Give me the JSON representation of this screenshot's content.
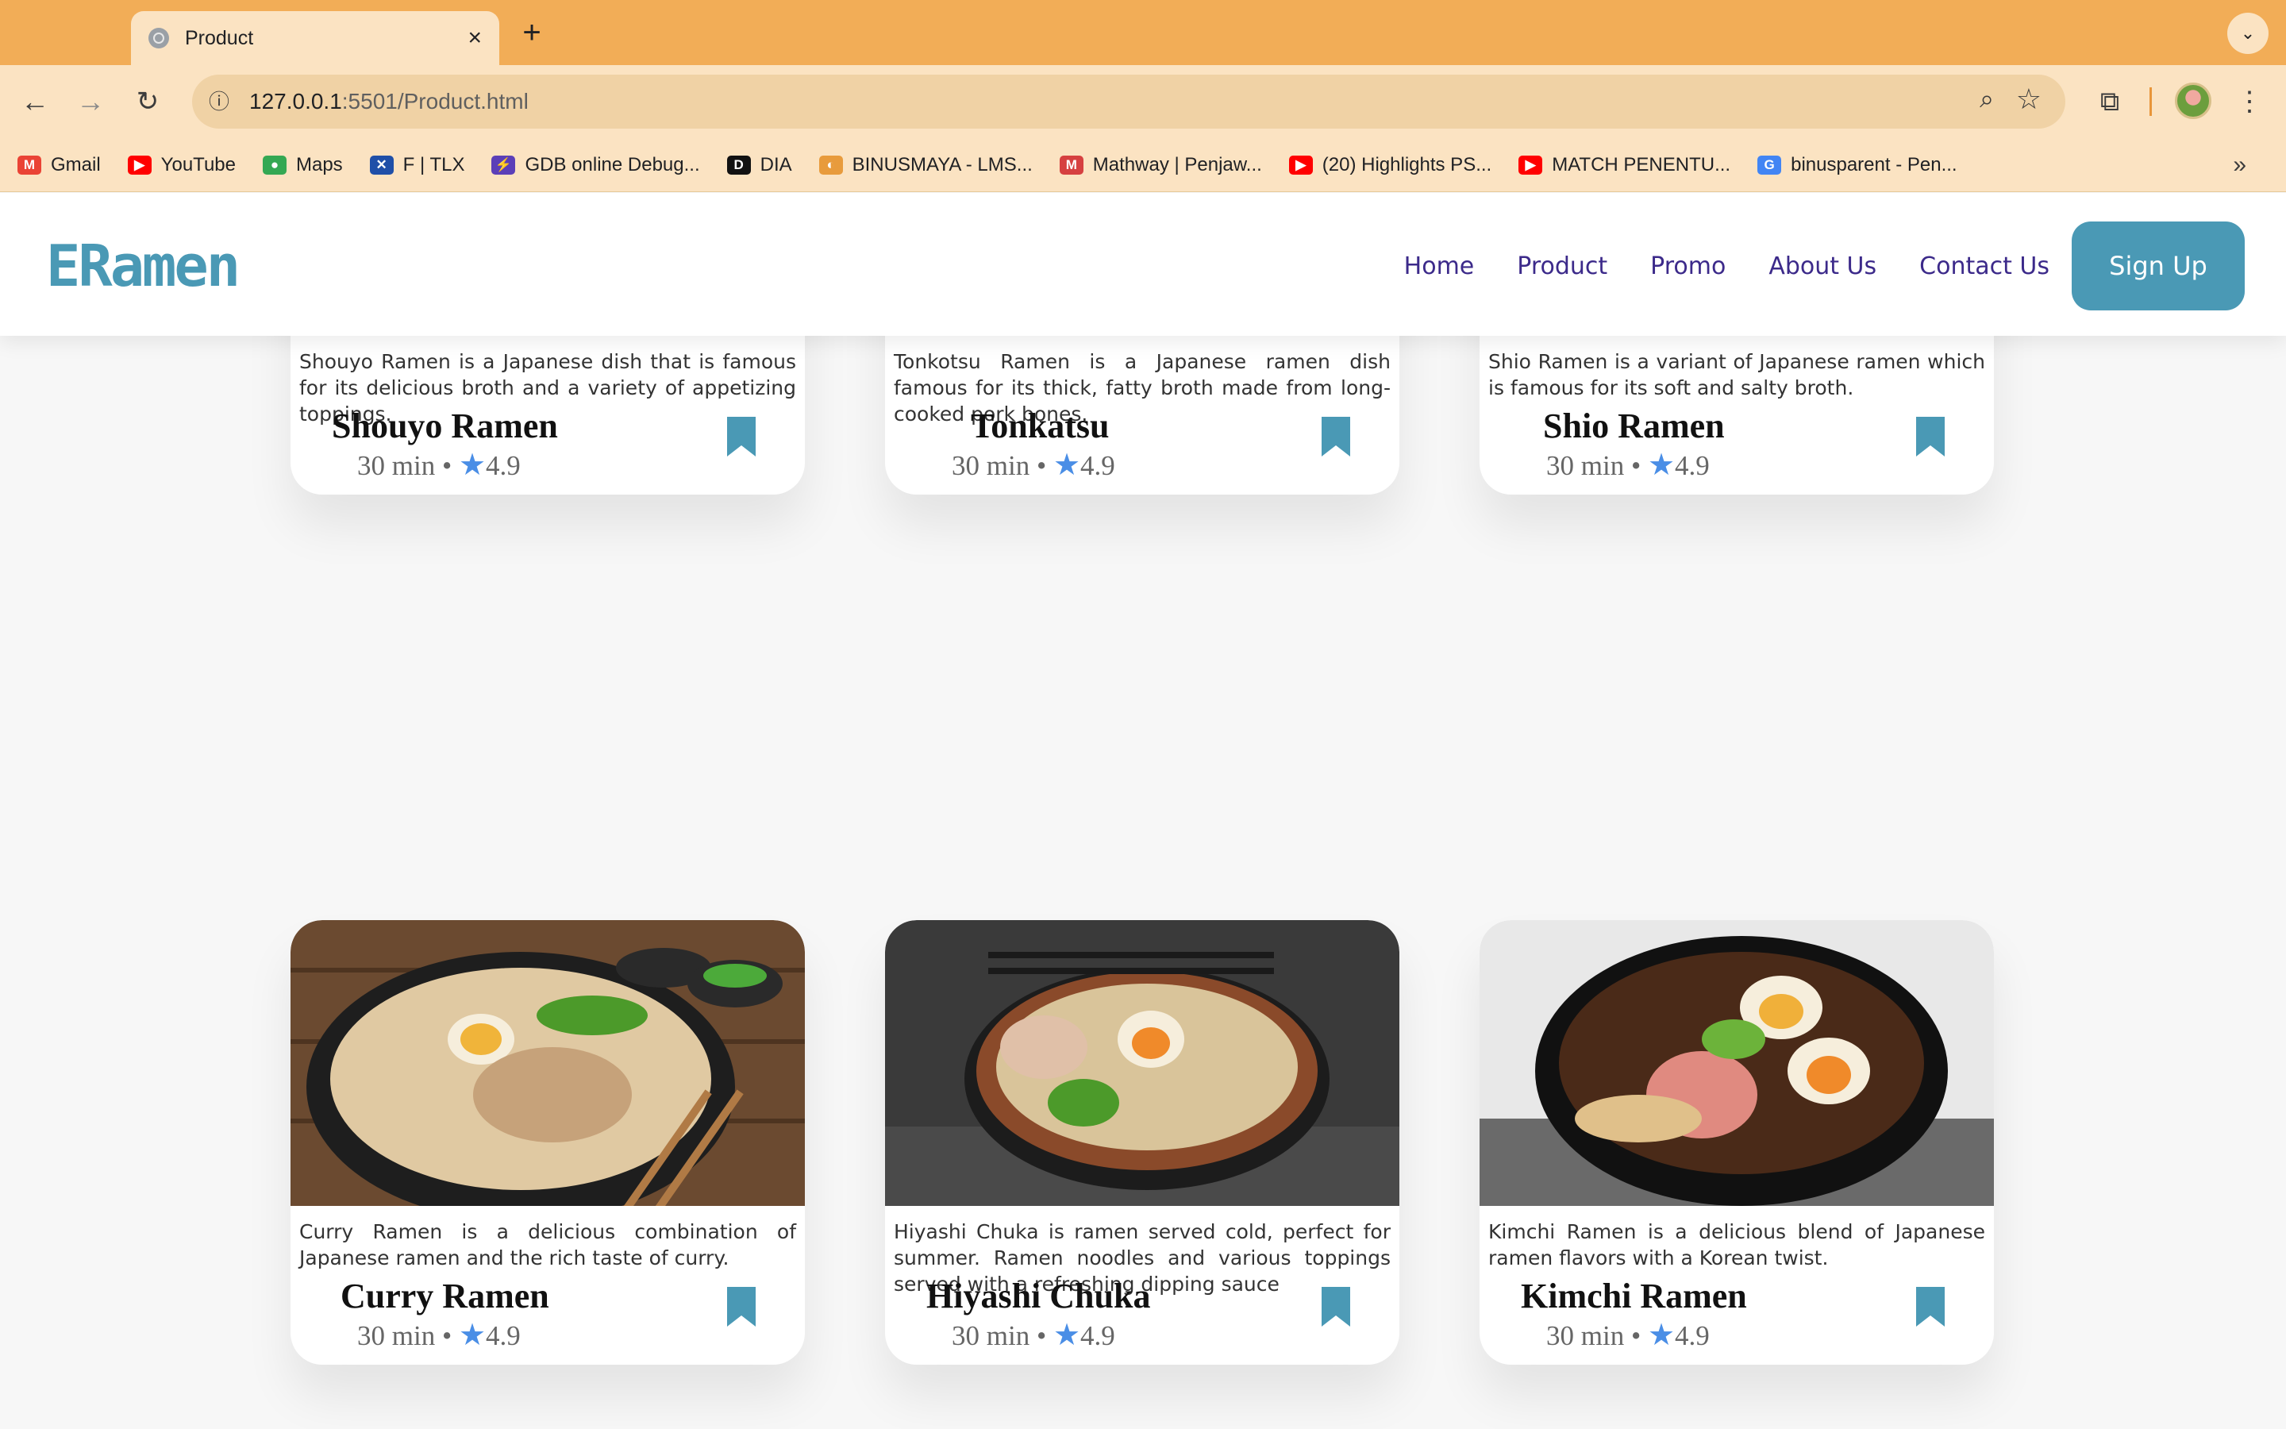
{
  "browser": {
    "tab_title": "Product",
    "url_host": "127.0.0.1",
    "url_path": ":5501/Product.html",
    "accent": "#f2ad57"
  },
  "bookmarks": [
    {
      "label": "Gmail",
      "icon": "gmail-icon",
      "color": "#ea4335",
      "glyph": "M"
    },
    {
      "label": "YouTube",
      "icon": "youtube-icon",
      "color": "#ff0000",
      "glyph": "▶"
    },
    {
      "label": "Maps",
      "icon": "maps-icon",
      "color": "#34a853",
      "glyph": "●"
    },
    {
      "label": "F | TLX",
      "icon": "tlx-icon",
      "color": "#1f4fa8",
      "glyph": "✕"
    },
    {
      "label": "GDB online Debug...",
      "icon": "gdb-icon",
      "color": "#5b3fb8",
      "glyph": "⚡"
    },
    {
      "label": "DIA",
      "icon": "dia-icon",
      "color": "#111111",
      "glyph": "D"
    },
    {
      "label": "BINUSMAYA - LMS...",
      "icon": "binus-icon",
      "color": "#e89b3c",
      "glyph": "◐"
    },
    {
      "label": "Mathway | Penjaw...",
      "icon": "mathway-icon",
      "color": "#d64040",
      "glyph": "M"
    },
    {
      "label": "(20) Highlights PS...",
      "icon": "youtube-icon",
      "color": "#ff0000",
      "glyph": "▶"
    },
    {
      "label": "MATCH PENENTU...",
      "icon": "youtube-icon",
      "color": "#ff0000",
      "glyph": "▶"
    },
    {
      "label": "binusparent - Pen...",
      "icon": "google-icon",
      "color": "#4285f4",
      "glyph": "G"
    }
  ],
  "site": {
    "logo": "ERamen",
    "nav": [
      "Home",
      "Product",
      "Promo",
      "About Us",
      "Contact Us"
    ],
    "signup": "Sign Up",
    "brand_color": "#4a99b5"
  },
  "products": [
    {
      "name": "Shouyo Ramen",
      "desc": "Shouyo Ramen is a Japanese dish that is famous for its delicious broth and a variety of appetizing toppings.",
      "time": "30 min",
      "rating": "4.9"
    },
    {
      "name": "Tonkatsu",
      "desc": "Tonkotsu Ramen is a Japanese ramen dish famous for its thick, fatty broth made from long-cooked pork bones.",
      "time": "30 min",
      "rating": "4.9"
    },
    {
      "name": "Shio Ramen",
      "desc": "Shio Ramen is a variant of Japanese ramen which is famous for its soft and salty broth.",
      "time": "30 min",
      "rating": "4.9"
    },
    {
      "name": "Curry Ramen",
      "desc": "Curry Ramen is a delicious combination of Japanese ramen and the rich taste of curry.",
      "time": "30 min",
      "rating": "4.9"
    },
    {
      "name": "Hiyashi Chuka",
      "desc": "Hiyashi Chuka is ramen served cold, perfect for summer. Ramen noodles and various toppings served with a refreshing dipping sauce",
      "time": "30 min",
      "rating": "4.9"
    },
    {
      "name": "Kimchi Ramen",
      "desc": "Kimchi Ramen is a delicious blend of Japanese ramen flavors with a Korean twist.",
      "time": "30 min",
      "rating": "4.9"
    }
  ]
}
